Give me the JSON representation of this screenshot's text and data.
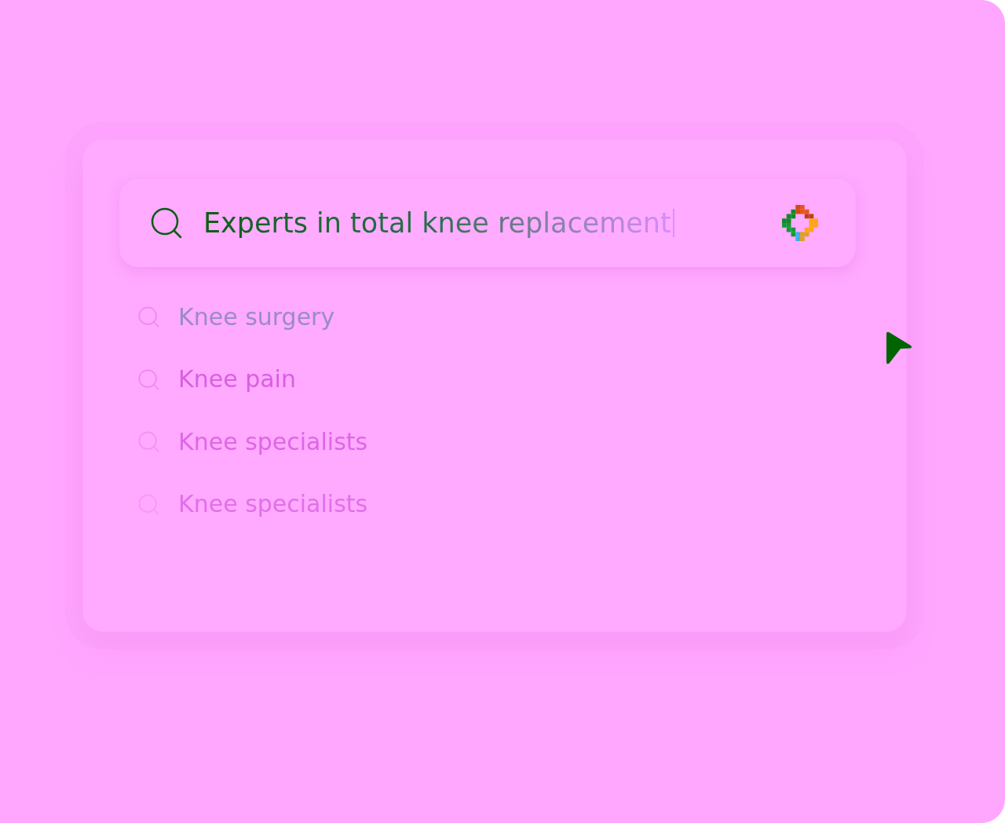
{
  "search": {
    "value": "Experts in total knee replacement",
    "focused": true
  },
  "suggestions": [
    {
      "label": "Knee surgery",
      "selected": true
    },
    {
      "label": "Knee pain",
      "selected": false
    },
    {
      "label": "Knee specialists",
      "selected": false
    },
    {
      "label": "Knee specialists",
      "selected": false
    }
  ]
}
